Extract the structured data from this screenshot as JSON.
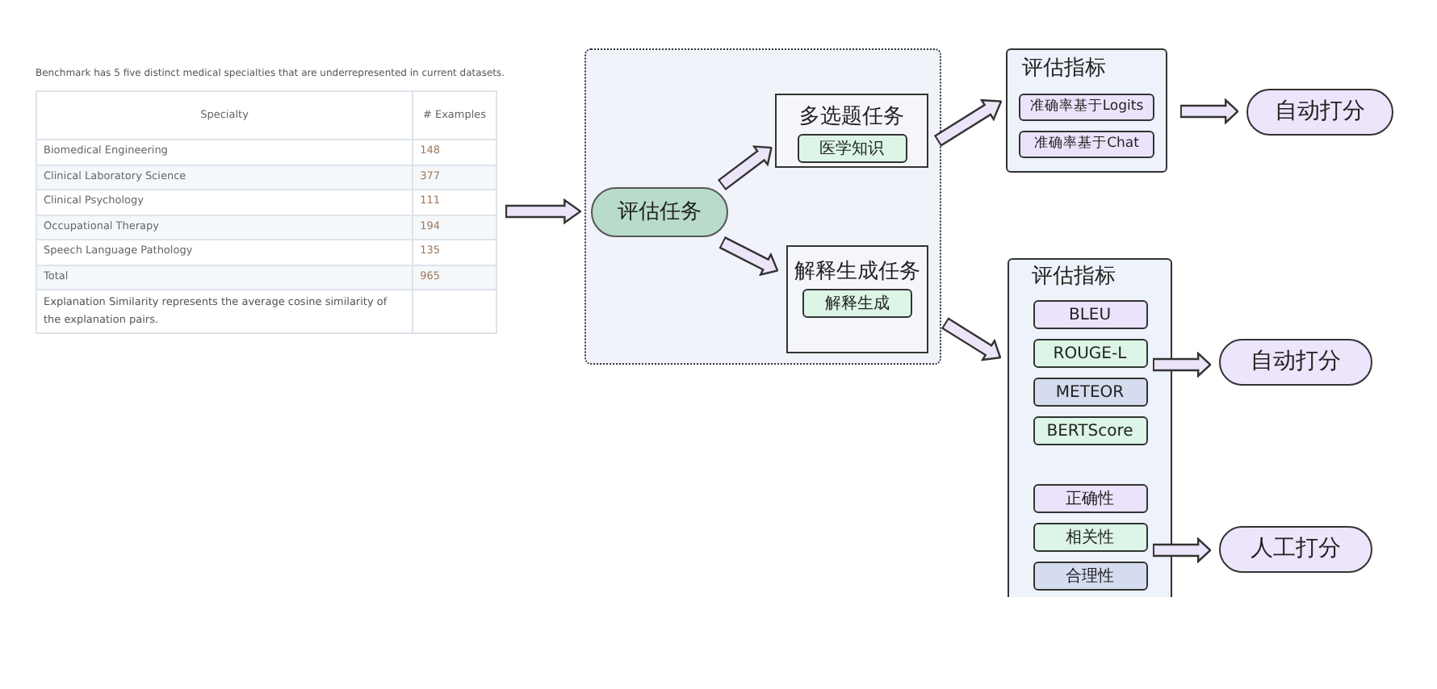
{
  "table": {
    "caption": "Benchmark has 5 five distinct medical specialties that are underrepresented in current datasets.",
    "columns": [
      "Specialty",
      "# Examples"
    ],
    "rows": [
      {
        "cells": [
          "Biomedical Engineering",
          "148"
        ]
      },
      {
        "cells": [
          "Clinical Laboratory Science",
          "377"
        ]
      },
      {
        "cells": [
          "Clinical Psychology",
          "111"
        ]
      },
      {
        "cells": [
          "Occupational Therapy",
          "194"
        ]
      },
      {
        "cells": [
          "Speech Language Pathology",
          "135"
        ]
      },
      {
        "cells": [
          "Total",
          "965"
        ]
      },
      {
        "cells": [
          "Explanation Similarity represents the average cosine similarity of the explanation pairs."
        ]
      }
    ]
  },
  "diagram": {
    "start": "评估任务",
    "tasks": [
      {
        "title": "多选题任务",
        "item": "医学知识"
      },
      {
        "title": "解释生成任务",
        "item": "解释生成"
      }
    ],
    "metric_groups": [
      {
        "title": "评估指标",
        "sections": [
          {
            "items": [
              {
                "label": "准确率基于Logits",
                "color": "#ebe3fb"
              },
              {
                "label": "准确率基于Chat",
                "color": "#ebe3fb"
              }
            ],
            "outcome": "自动打分"
          }
        ]
      },
      {
        "title": "评估指标",
        "sections": [
          {
            "items": [
              {
                "label": "BLEU",
                "color": "#ebe3fb"
              },
              {
                "label": "ROUGE-L",
                "color": "#dcf5e6"
              },
              {
                "label": "METEOR",
                "color": "#d5dcef"
              },
              {
                "label": "BERTScore",
                "color": "#dcf5e6"
              }
            ],
            "outcome": "自动打分"
          },
          {
            "items": [
              {
                "label": "正确性",
                "color": "#ebe3fb"
              },
              {
                "label": "相关性",
                "color": "#dcf5e6"
              },
              {
                "label": "合理性",
                "color": "#d5dcef"
              }
            ],
            "outcome": "人工打分"
          }
        ]
      }
    ]
  }
}
